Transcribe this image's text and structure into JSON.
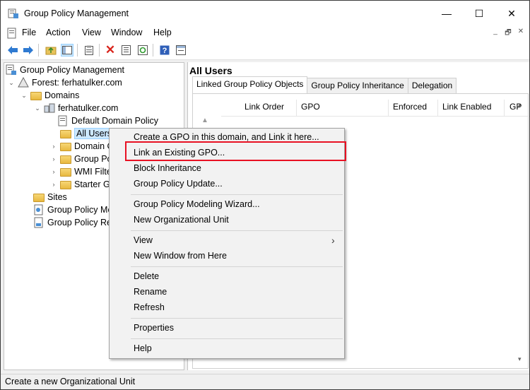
{
  "window": {
    "title": "Group Policy Management",
    "controls": {
      "minimize": "—",
      "maximize": "☐",
      "close": "✕"
    }
  },
  "menu": {
    "items": [
      "File",
      "Action",
      "View",
      "Window",
      "Help"
    ],
    "mdi": {
      "minimize": "_",
      "restore": "🗗",
      "close": "✕"
    }
  },
  "toolbar": {
    "buttons": [
      "back-arrow-icon",
      "forward-arrow-icon",
      "up-folder-icon",
      "show-hide-tree-icon",
      "properties-icon",
      "delete-icon",
      "export-list-icon",
      "refresh-icon",
      "help-icon",
      "properties-view-icon"
    ]
  },
  "tree": {
    "root": "Group Policy Management",
    "forest": "Forest: ferhatulker.com",
    "domains": "Domains",
    "domain": "ferhatulker.com",
    "default_policy": "Default Domain Policy",
    "all_users": "All Users",
    "domain_controllers": "Domain C",
    "group_policy_objects": "Group Po",
    "wmi_filters": "WMI Filte",
    "starter_gpos": "Starter GI",
    "sites": "Sites",
    "modeling": "Group Policy Mo",
    "results": "Group Policy Re"
  },
  "main": {
    "title": "All Users",
    "tabs": [
      "Linked Group Policy Objects",
      "Group Policy Inheritance",
      "Delegation"
    ],
    "columns": [
      "Link Order",
      "GPO",
      "Enforced",
      "Link Enabled",
      "GP"
    ]
  },
  "context_menu": {
    "items": [
      "Create a GPO in this domain, and Link it here...",
      "Link an Existing GPO...",
      "Block Inheritance",
      "Group Policy Update...",
      "Group Policy Modeling Wizard...",
      "New Organizational Unit",
      "View",
      "New Window from Here",
      "Delete",
      "Rename",
      "Refresh",
      "Properties",
      "Help"
    ],
    "submenu_arrow": "›"
  },
  "status": {
    "text": "Create a new Organizational Unit"
  },
  "colors": {
    "highlight": "#e81123",
    "selection": "#cce8ff"
  }
}
